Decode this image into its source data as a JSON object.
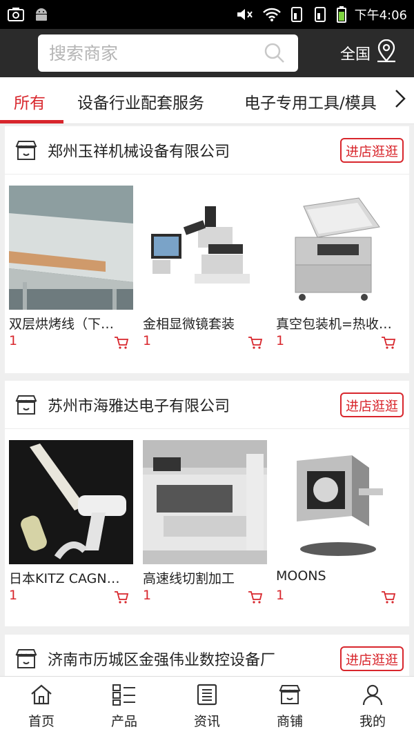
{
  "status_bar": {
    "time": "下午4:06"
  },
  "search": {
    "placeholder": "搜索商家"
  },
  "region": {
    "label": "全国"
  },
  "tabs": [
    {
      "label": "所有"
    },
    {
      "label": "设备行业配套服务"
    },
    {
      "label": "电子专用工具/模具"
    }
  ],
  "stores": [
    {
      "name": "郑州玉祥机械设备有限公司",
      "visit_label": "进店逛逛",
      "products": [
        {
          "name": "双层烘烤线（下…",
          "price": "1"
        },
        {
          "name": "金相显微镜套装",
          "price": "1"
        },
        {
          "name": "真空包装机=热收…",
          "price": "1"
        }
      ]
    },
    {
      "name": "苏州市海雅达电子有限公司",
      "visit_label": "进店逛逛",
      "products": [
        {
          "name": "日本KITZ CAGN…",
          "price": "1"
        },
        {
          "name": "高速线切割加工",
          "price": "1"
        },
        {
          "name": "MOONS",
          "price": "1"
        }
      ]
    },
    {
      "name": "济南市历城区金强伟业数控设备厂",
      "visit_label": "进店逛逛"
    }
  ],
  "bottom_nav": [
    {
      "label": "首页",
      "icon": "home-icon"
    },
    {
      "label": "产品",
      "icon": "product-list-icon"
    },
    {
      "label": "资讯",
      "icon": "news-icon"
    },
    {
      "label": "商铺",
      "icon": "shop-icon"
    },
    {
      "label": "我的",
      "icon": "user-icon"
    }
  ],
  "colors": {
    "accent": "#d8262c",
    "header_bg": "#2b2b2b",
    "page_bg": "#efefef"
  }
}
